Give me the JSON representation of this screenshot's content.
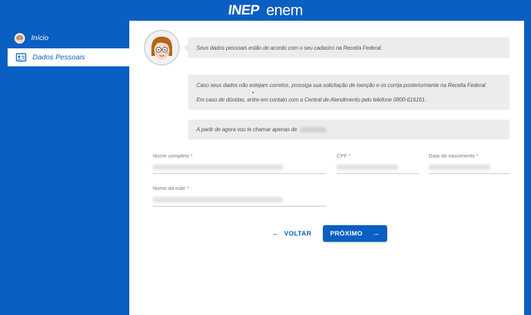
{
  "header": {
    "logo_inep": "INEP",
    "logo_enem": "enem"
  },
  "sidebar": {
    "items": [
      {
        "label": "Início",
        "icon": "user-avatar-icon",
        "active": false
      },
      {
        "label": "Dados Pessoais",
        "icon": "id-card-icon",
        "active": true
      }
    ]
  },
  "chat": {
    "messages": [
      "Seus dados pessoais estão de acordo com o seu cadastro na Receita Federal.",
      "Caso seus dados não estejam corretos, prossiga sua solicitação de isenção e os corrija posteriormente na Receita Federal.",
      "Em caso de dúvidas, entre em contato com a Central de Atendimento pelo telefone 0800-616161.",
      "A partir de agora vou te chamar apenas de"
    ]
  },
  "form": {
    "nome_label": "Nome completo *",
    "cpf_label": "CPF *",
    "nascimento_label": "Data de nascimento *",
    "mae_label": "Nome da mãe *"
  },
  "actions": {
    "back_label": "VOLTAR",
    "next_label": "PRÓXIMO"
  },
  "colors": {
    "primary": "#0a5fc2",
    "bubble": "#ececec"
  }
}
